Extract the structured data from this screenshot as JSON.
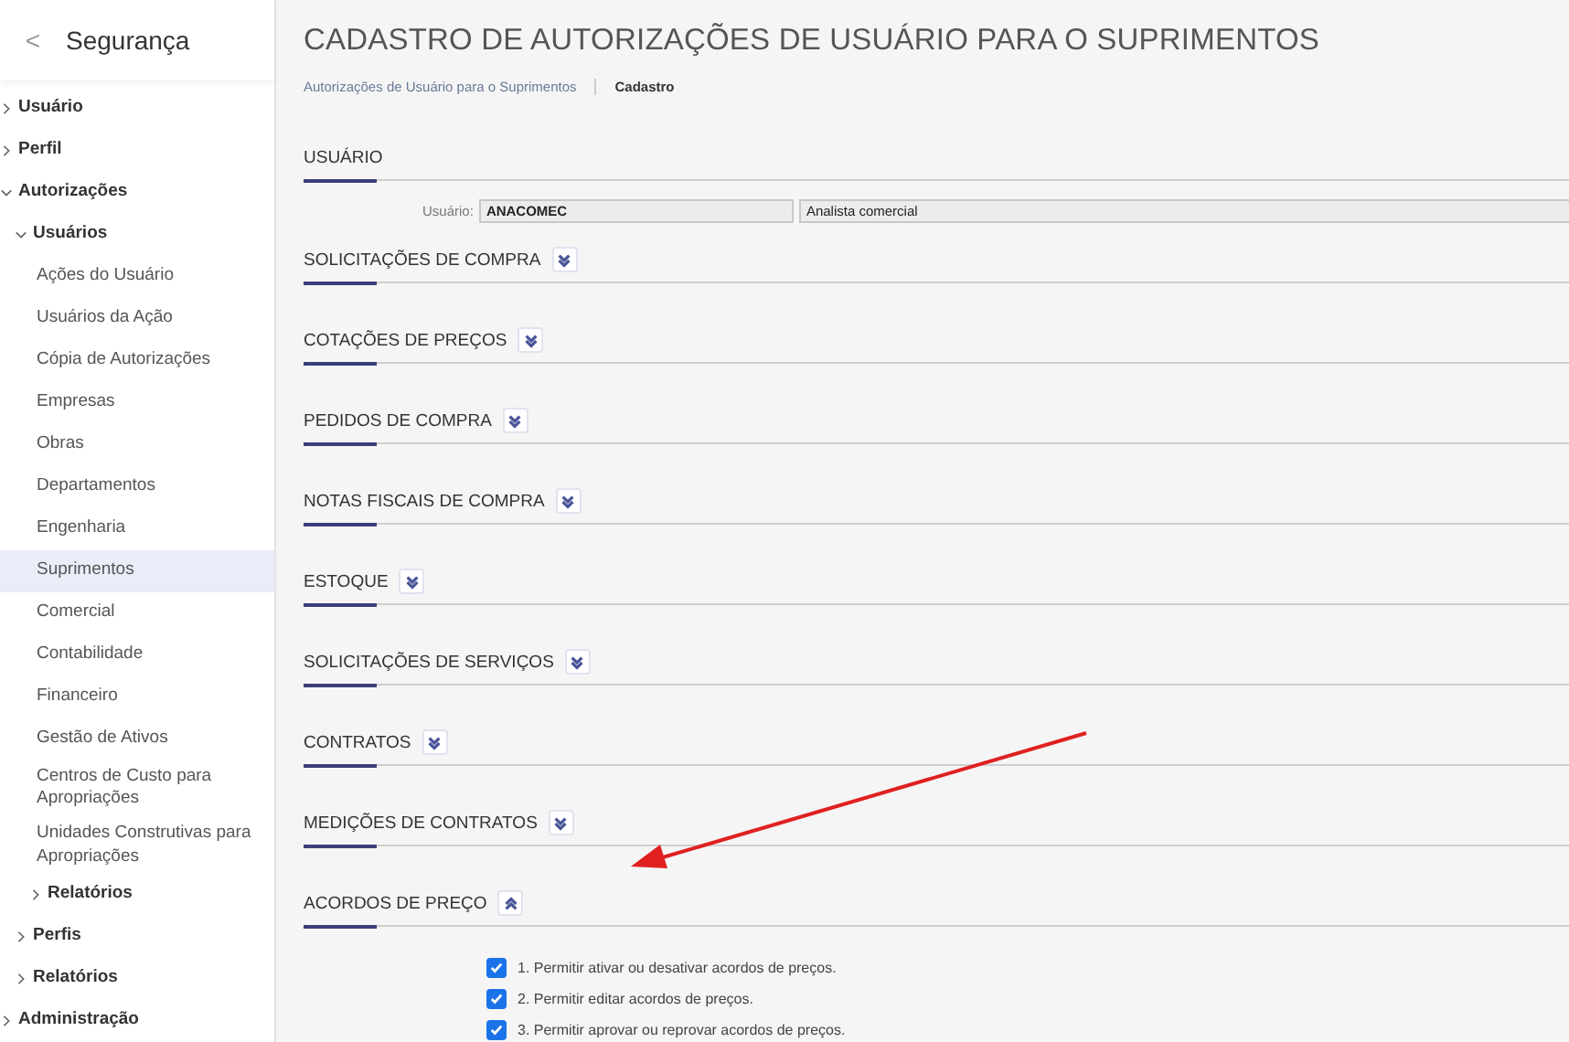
{
  "sidebar": {
    "back": "<",
    "title": "Segurança",
    "items": [
      {
        "kind": "group",
        "label": "Usuário",
        "expanded": false
      },
      {
        "kind": "group",
        "label": "Perfil",
        "expanded": false
      },
      {
        "kind": "group",
        "label": "Autorizações",
        "expanded": true,
        "children": [
          {
            "kind": "group",
            "label": "Usuários",
            "expanded": true,
            "children": [
              {
                "kind": "leaf",
                "label": "Ações do Usuário",
                "selected": false
              },
              {
                "kind": "leaf",
                "label": "Usuários da Ação",
                "selected": false
              },
              {
                "kind": "leaf",
                "label": "Cópia de Autorizações",
                "selected": false
              },
              {
                "kind": "leaf",
                "label": "Empresas",
                "selected": false
              },
              {
                "kind": "leaf",
                "label": "Obras",
                "selected": false
              },
              {
                "kind": "leaf",
                "label": "Departamentos",
                "selected": false
              },
              {
                "kind": "leaf",
                "label": "Engenharia",
                "selected": false
              },
              {
                "kind": "leaf",
                "label": "Suprimentos",
                "selected": true
              },
              {
                "kind": "leaf",
                "label": "Comercial",
                "selected": false
              },
              {
                "kind": "leaf",
                "label": "Contabilidade",
                "selected": false
              },
              {
                "kind": "leaf",
                "label": "Financeiro",
                "selected": false
              },
              {
                "kind": "leaf",
                "label": "Gestão de Ativos",
                "selected": false
              },
              {
                "kind": "leaf",
                "label": "Centros de Custo para Apropriações",
                "selected": false
              },
              {
                "kind": "leaf",
                "label": "Unidades Construtivas para Apropriações",
                "selected": false
              },
              {
                "kind": "group",
                "label": "Relatórios",
                "expanded": false
              }
            ]
          },
          {
            "kind": "group",
            "label": "Perfis",
            "expanded": false
          },
          {
            "kind": "group",
            "label": "Relatórios",
            "expanded": false
          }
        ]
      },
      {
        "kind": "group",
        "label": "Administração",
        "expanded": false
      }
    ]
  },
  "page": {
    "title": "CADASTRO DE AUTORIZAÇÕES DE USUÁRIO PARA O SUPRIMENTOS",
    "breadcrumb": [
      {
        "label": "Autorizações de Usuário para o Suprimentos",
        "current": false
      },
      {
        "label": "Cadastro",
        "current": true
      }
    ]
  },
  "user_section": {
    "title": "USUÁRIO",
    "field_label": "Usuário:",
    "user_value": "ANACOMEC",
    "role_value": "Analista comercial"
  },
  "sections": [
    {
      "title": "SOLICITAÇÕES DE COMPRA",
      "expanded": false
    },
    {
      "title": "COTAÇÕES DE PREÇOS",
      "expanded": false
    },
    {
      "title": "PEDIDOS DE COMPRA",
      "expanded": false
    },
    {
      "title": "NOTAS FISCAIS DE COMPRA",
      "expanded": false
    },
    {
      "title": "ESTOQUE",
      "expanded": false
    },
    {
      "title": "SOLICITAÇÕES DE SERVIÇOS",
      "expanded": false
    },
    {
      "title": "CONTRATOS",
      "expanded": false
    },
    {
      "title": "MEDIÇÕES DE CONTRATOS",
      "expanded": false
    },
    {
      "title": "ACORDOS DE PREÇO",
      "expanded": true,
      "options": [
        {
          "label": "1. Permitir ativar ou desativar acordos de preços.",
          "checked": true
        },
        {
          "label": "2. Permitir editar acordos de preços.",
          "checked": true
        },
        {
          "label": "3. Permitir aprovar ou reprovar acordos de preços.",
          "checked": true
        }
      ]
    }
  ]
}
